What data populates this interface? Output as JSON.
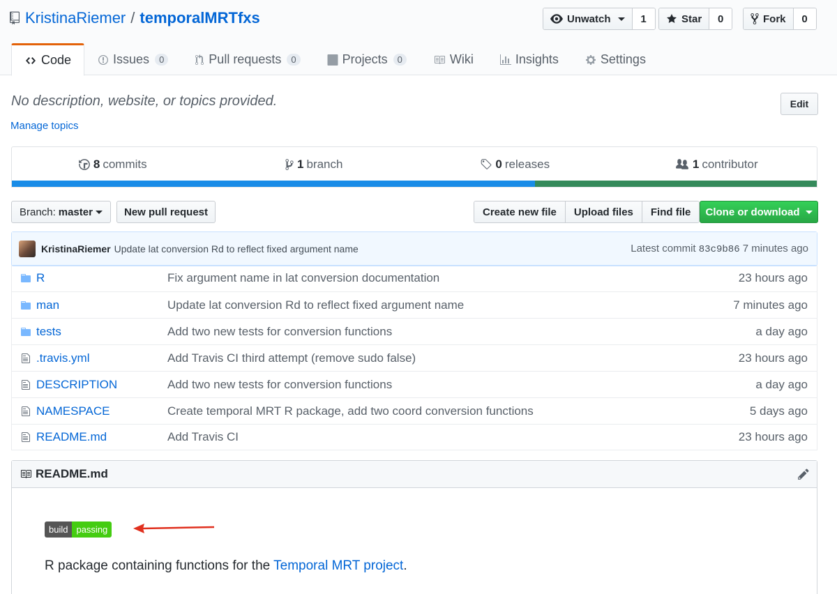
{
  "repo": {
    "owner": "KristinaRiemer",
    "separator": "/",
    "name": "temporalMRTfxs"
  },
  "actions": {
    "watch": {
      "label": "Unwatch",
      "count": "1"
    },
    "star": {
      "label": "Star",
      "count": "0"
    },
    "fork": {
      "label": "Fork",
      "count": "0"
    }
  },
  "tabs": [
    {
      "label": "Code",
      "counter": ""
    },
    {
      "label": "Issues",
      "counter": "0"
    },
    {
      "label": "Pull requests",
      "counter": "0"
    },
    {
      "label": "Projects",
      "counter": "0"
    },
    {
      "label": "Wiki",
      "counter": ""
    },
    {
      "label": "Insights",
      "counter": ""
    },
    {
      "label": "Settings",
      "counter": ""
    }
  ],
  "description": {
    "text": "No description, website, or topics provided.",
    "manage_topics": "Manage topics",
    "edit_label": "Edit"
  },
  "summary": {
    "commits_count": "8",
    "commits_label": "commits",
    "branches_count": "1",
    "branches_label": "branch",
    "releases_count": "0",
    "releases_label": "releases",
    "contributors_count": "1",
    "contributors_label": "contributor"
  },
  "language_colors": {
    "r": "#198ce7",
    "other": "#358a5b"
  },
  "file_nav": {
    "branch_prefix": "Branch:",
    "branch_name": "master",
    "new_pr": "New pull request",
    "create_file": "Create new file",
    "upload_files": "Upload files",
    "find_file": "Find file",
    "clone": "Clone or download"
  },
  "latest_commit": {
    "author": "KristinaRiemer",
    "message": "Update lat conversion Rd to reflect fixed argument name",
    "prefix": "Latest commit",
    "sha": "83c9b86",
    "age": "7 minutes ago"
  },
  "files": [
    {
      "name": "R",
      "type": "dir",
      "message": "Fix argument name in lat conversion documentation",
      "age": "23 hours ago"
    },
    {
      "name": "man",
      "type": "dir",
      "message": "Update lat conversion Rd to reflect fixed argument name",
      "age": "7 minutes ago"
    },
    {
      "name": "tests",
      "type": "dir",
      "message": "Add two new tests for conversion functions",
      "age": "a day ago"
    },
    {
      "name": ".travis.yml",
      "type": "file",
      "message": "Add Travis CI third attempt (remove sudo false)",
      "age": "23 hours ago"
    },
    {
      "name": "DESCRIPTION",
      "type": "file",
      "message": "Add two new tests for conversion functions",
      "age": "a day ago"
    },
    {
      "name": "NAMESPACE",
      "type": "file",
      "message": "Create temporal MRT R package, add two coord conversion functions",
      "age": "5 days ago"
    },
    {
      "name": "README.md",
      "type": "file",
      "message": "Add Travis CI",
      "age": "23 hours ago"
    }
  ],
  "readme": {
    "title": "README.md",
    "badge_left": "build",
    "badge_right": "passing",
    "text_before": "R package containing functions for the ",
    "link_text": "Temporal MRT project",
    "text_after": "."
  }
}
